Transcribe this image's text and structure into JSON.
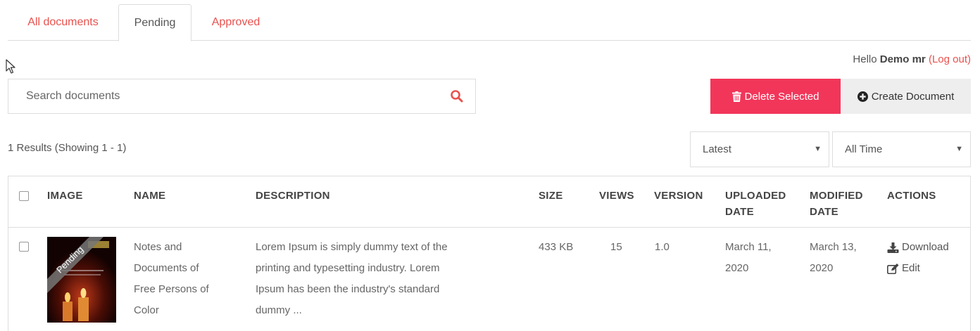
{
  "tabs": [
    {
      "label": "All documents"
    },
    {
      "label": "Pending"
    },
    {
      "label": "Approved"
    }
  ],
  "user": {
    "greeting": "Hello",
    "name": "Demo mr",
    "open_paren": "(",
    "logout": "Log out",
    "close_paren": ")"
  },
  "search": {
    "placeholder": "Search documents",
    "value": ""
  },
  "buttons": {
    "delete": "Delete Selected",
    "create": "Create Document"
  },
  "results_text": "1 Results (Showing 1 - 1)",
  "filters": {
    "sort": "Latest",
    "period": "All Time"
  },
  "columns": {
    "image": "IMAGE",
    "name": "NAME",
    "description": "DESCRIPTION",
    "size": "SIZE",
    "views": "VIEWS",
    "version": "VERSION",
    "uploaded_1": "UPLOADED",
    "uploaded_2": "DATE",
    "modified_1": "MODIFIED",
    "modified_2": "DATE",
    "actions": "ACTIONS"
  },
  "rows": [
    {
      "name_lines": [
        "Notes and",
        "Documents of",
        "Free Persons of",
        "Color"
      ],
      "description_lines": [
        "Lorem Ipsum is simply dummy text of the",
        "printing and typesetting industry. Lorem",
        "Ipsum has been the industry's standard",
        "dummy ..."
      ],
      "size": "433 KB",
      "views": "15",
      "version": "1.0",
      "uploaded_lines": [
        "March 11,",
        "2020"
      ],
      "modified_lines": [
        "March 13,",
        "2020"
      ],
      "badge": "Pending",
      "actions": {
        "download": "Download",
        "edit": "Edit"
      }
    }
  ],
  "colors": {
    "accent": "#e8524e",
    "delete_bg": "#f2365a",
    "create_bg": "#eeeeee"
  }
}
